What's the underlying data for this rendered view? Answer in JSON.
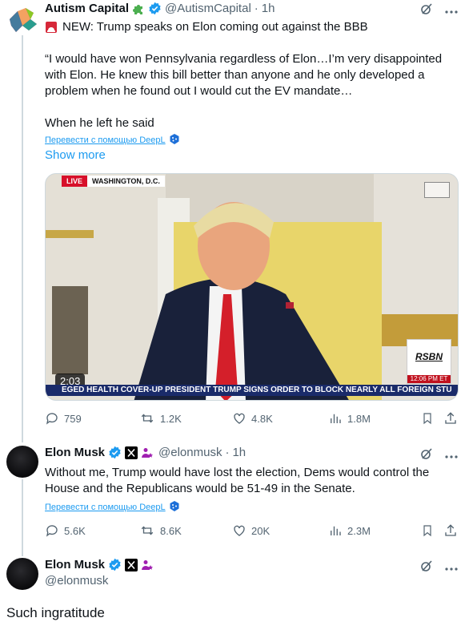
{
  "tweet1": {
    "name": "Autism Capital",
    "handle": "@AutismCapital",
    "time": "1h",
    "line1": "NEW: Trump speaks on Elon coming out against the BBB",
    "line2": "“I would have won Pennsylvania regardless of Elon…I’m very disappointed with Elon. He knew this bill better than anyone and he only developed a problem when he found out I would cut the EV mandate…",
    "line3": "When he left he said",
    "translate": "Перевести с помощью DeepL",
    "show_more": "Show more",
    "video": {
      "live": "LIVE",
      "location": "WASHINGTON, D.C.",
      "duration": "2:03",
      "chyron": "EGED HEALTH COVER-UP    PRESIDENT TRUMP SIGNS ORDER TO BLOCK NEARLY ALL FOREIGN STU",
      "logo": "RSBN",
      "logo_time": "12:06 PM ET"
    },
    "actions": {
      "replies": "759",
      "reposts": "1.2K",
      "likes": "4.8K",
      "views": "1.8M"
    }
  },
  "tweet2": {
    "name": "Elon Musk",
    "handle": "@elonmusk",
    "time": "1h",
    "text": "Without me, Trump would have lost the election, Dems would control the House and the Republicans would be 51-49 in the Senate.",
    "translate": "Перевести с помощью DeepL",
    "actions": {
      "replies": "5.6K",
      "reposts": "8.6K",
      "likes": "20K",
      "views": "2.3M"
    }
  },
  "tweet3": {
    "name": "Elon Musk",
    "handle": "@elonmusk",
    "text": "Such ingratitude"
  },
  "colors": {
    "accent": "#1d9bf0",
    "muted": "#536471",
    "verified": "#1d9bf0"
  }
}
